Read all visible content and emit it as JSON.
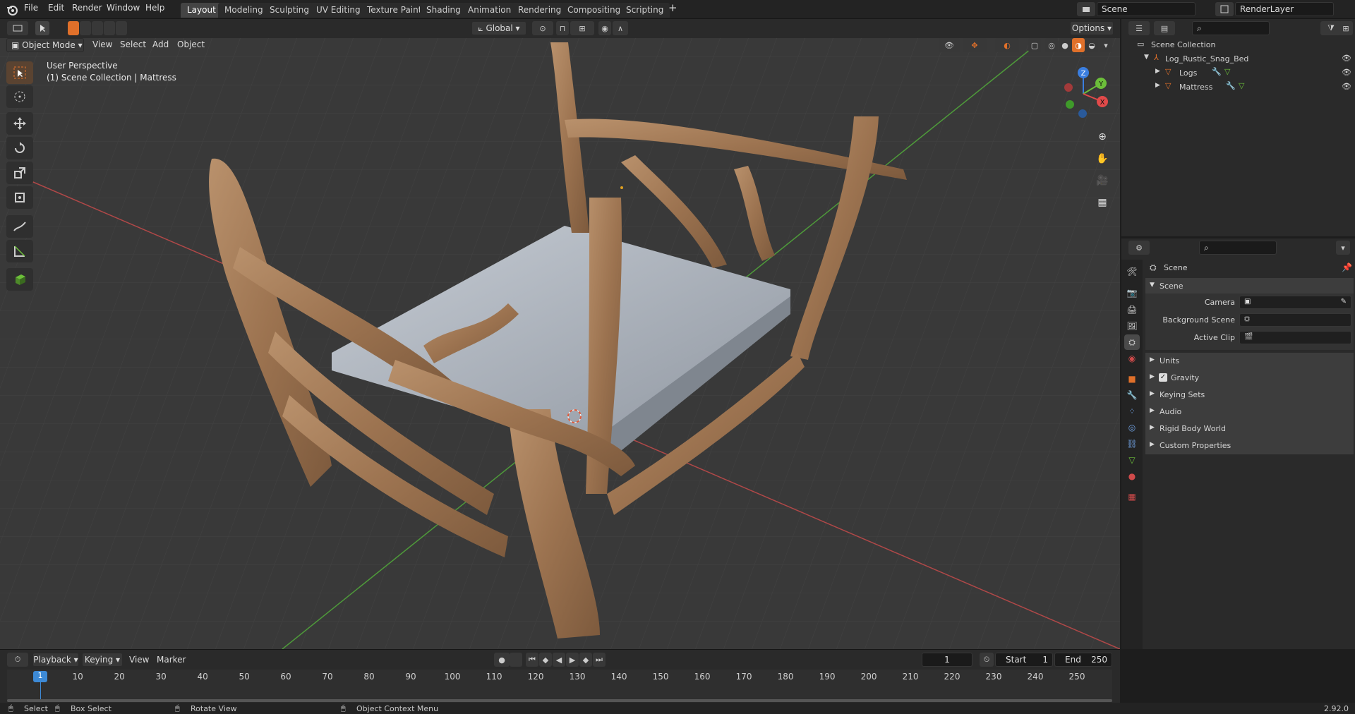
{
  "top_menu": [
    "File",
    "Edit",
    "Render",
    "Window",
    "Help"
  ],
  "workspaces": [
    "Layout",
    "Modeling",
    "Sculpting",
    "UV Editing",
    "Texture Paint",
    "Shading",
    "Animation",
    "Rendering",
    "Compositing",
    "Scripting"
  ],
  "active_workspace": "Layout",
  "add_tab": "+",
  "scene_field": "Scene",
  "render_layer_field": "RenderLayer",
  "viewport": {
    "mode": "Object Mode",
    "menus": [
      "View",
      "Select",
      "Add",
      "Object"
    ],
    "orientation": "Global",
    "options_label": "Options",
    "perspective_label": "User Perspective",
    "context_label": "(1) Scene Collection | Mattress",
    "gizmo_axes": {
      "x": "X",
      "y": "Y",
      "z": "Z"
    }
  },
  "tools": [
    "select-box",
    "cursor",
    "move",
    "rotate",
    "scale",
    "transform",
    "annotate",
    "measure",
    "add-cube"
  ],
  "outliner": {
    "root": "Scene Collection",
    "items": [
      {
        "name": "Log_Rustic_Snag_Bed",
        "level": 1
      },
      {
        "name": "Logs",
        "level": 2
      },
      {
        "name": "Mattress",
        "level": 2
      }
    ]
  },
  "properties": {
    "header": "Scene",
    "section": "Scene",
    "fields": [
      {
        "label": "Camera",
        "value": ""
      },
      {
        "label": "Background Scene",
        "value": ""
      },
      {
        "label": "Active Clip",
        "value": ""
      }
    ],
    "panels": [
      "Units",
      "Gravity",
      "Keying Sets",
      "Audio",
      "Rigid Body World",
      "Custom Properties"
    ],
    "gravity_checked": true
  },
  "timeline": {
    "menus": [
      "Playback",
      "Keying",
      "View",
      "Marker"
    ],
    "current_frame": "1",
    "start_label": "Start",
    "start": "1",
    "end_label": "End",
    "end": "250",
    "ticks": [
      "1",
      "10",
      "20",
      "30",
      "40",
      "50",
      "60",
      "70",
      "80",
      "90",
      "100",
      "110",
      "120",
      "130",
      "140",
      "150",
      "160",
      "170",
      "180",
      "190",
      "200",
      "210",
      "220",
      "230",
      "240",
      "250"
    ]
  },
  "statusbar": {
    "select": "Select",
    "box_select": "Box Select",
    "rotate_view": "Rotate View",
    "context_menu": "Object Context Menu",
    "version": "2.92.0"
  },
  "colors": {
    "accent": "#e0702a",
    "active_tool": "#5a4331",
    "x_axis": "#e24a4a",
    "y_axis": "#6cbf3a",
    "z_axis": "#3a7ee0",
    "wood": "#a87a55",
    "mattress": "#a9afb8"
  }
}
